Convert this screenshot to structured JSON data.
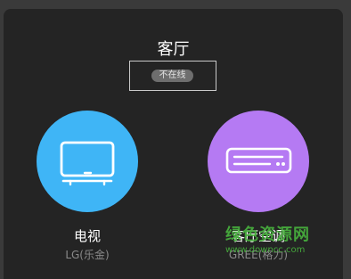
{
  "room": {
    "title": "客厅",
    "status": "不在线"
  },
  "devices": [
    {
      "name": "电视",
      "brand": "LG(乐金)",
      "icon": "tv-icon",
      "color": "#3fb5f6"
    },
    {
      "name": "客厅空调",
      "brand": "GREE(格力)",
      "icon": "air-conditioner-icon",
      "color": "#b57af3"
    }
  ],
  "watermark": {
    "text": "绿色资源网",
    "url": "www.downcc.com"
  },
  "colors": {
    "background": "#242424",
    "status_pill": "#6e6e6e",
    "watermark": "#47b03d"
  }
}
